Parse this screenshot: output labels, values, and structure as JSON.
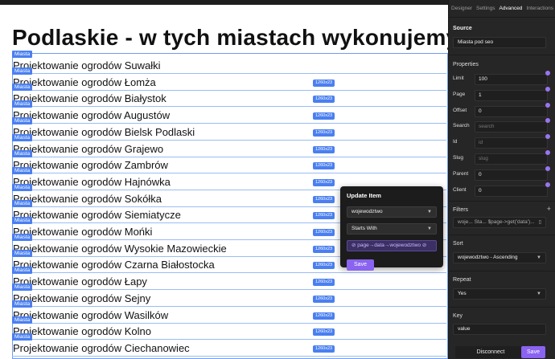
{
  "canvas": {
    "title": "Podlaskie - w tych miastach wykonujemy",
    "tag_label": "Miasta",
    "dim_label": "1260x23",
    "rows": [
      "Projektowanie ogrodów Suwałki",
      "Projektowanie ogrodów Łomża",
      "Projektowanie ogrodów Białystok",
      "Projektowanie ogrodów Augustów",
      "Projektowanie ogrodów Bielsk Podlaski",
      "Projektowanie ogrodów Grajewo",
      "Projektowanie ogrodów Zambrów",
      "Projektowanie ogrodów Hajnówka",
      "Projektowanie ogrodów Sokółka",
      "Projektowanie ogrodów Siemiatycze",
      "Projektowanie ogrodów Mońki",
      "Projektowanie ogrodów Wysokie Mazowieckie",
      "Projektowanie ogrodów Czarna Białostocka",
      "Projektowanie ogrodów Łapy",
      "Projektowanie ogrodów Sejny",
      "Projektowanie ogrodów Wasilków",
      "Projektowanie ogrodów Kolno",
      "Projektowanie ogrodów Ciechanowiec"
    ]
  },
  "popup": {
    "title": "Update Item",
    "field_value": "wojewodztwo",
    "operator_value": "Starts With",
    "binding_value": "page→data→wojewodztwo",
    "save_label": "Save"
  },
  "panel": {
    "tabs": [
      "Designer",
      "Settings",
      "Advanced",
      "Interactions"
    ],
    "active_tab": "Advanced",
    "source_label": "Source",
    "source_value": "Miasta pod seo",
    "properties_label": "Properties",
    "properties": [
      {
        "label": "Limit",
        "value": "100",
        "placeholder": ""
      },
      {
        "label": "Page",
        "value": "1",
        "placeholder": ""
      },
      {
        "label": "Offset",
        "value": "0",
        "placeholder": ""
      },
      {
        "label": "Search",
        "value": "",
        "placeholder": "search"
      },
      {
        "label": "Id",
        "value": "",
        "placeholder": "id"
      },
      {
        "label": "Slug",
        "value": "",
        "placeholder": "slug"
      },
      {
        "label": "Parent",
        "value": "0",
        "placeholder": ""
      },
      {
        "label": "Client",
        "value": "0",
        "placeholder": ""
      }
    ],
    "filters_label": "Filters",
    "filter_value": "woje...  Sta...  $page->get('data')...",
    "sort_label": "Sort",
    "sort_value": "wojewodztwo - Ascending",
    "repeat_label": "Repeat",
    "repeat_value": "Yes",
    "key_label": "Key",
    "key_value": "value",
    "disconnect_label": "Disconnect",
    "save_label": "Save"
  },
  "colors": {
    "accent": "#8a63f0",
    "selection": "#4a7ff0",
    "panel_bg": "#262626"
  }
}
